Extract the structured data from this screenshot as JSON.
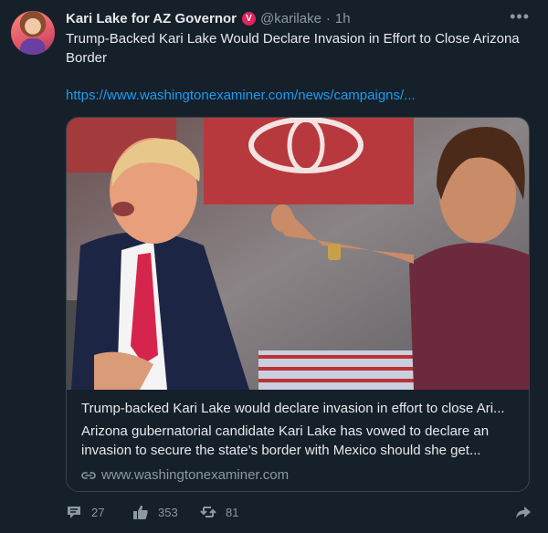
{
  "author": {
    "name": "Kari Lake for AZ Governor",
    "verified_badge": "V",
    "handle": "@karilake",
    "separator": "·",
    "time": "1h"
  },
  "tweet": {
    "text": "Trump-Backed Kari Lake Would Declare  Invasion in Effort to Close Arizona Border",
    "link": "https://www.washingtonexaminer.com/news/campaigns/..."
  },
  "card": {
    "title": "Trump-backed Kari Lake would declare invasion in effort to close Ari...",
    "description": "Arizona gubernatorial candidate Kari Lake has vowed to declare an invasion to secure the state’s border with Mexico should she get...",
    "domain": "www.washingtonexaminer.com"
  },
  "actions": {
    "replies": "27",
    "likes": "353",
    "retweets": "81"
  },
  "icons": {
    "more": "more-options-icon",
    "reply": "reply-icon",
    "like": "thumbs-up-icon",
    "retweet": "retweet-icon",
    "share": "share-arrow-icon",
    "link": "link-icon"
  },
  "colors": {
    "background": "#15202b",
    "link": "#1d9bf0",
    "muted": "#8b98a5",
    "verified": "#e0245e"
  }
}
